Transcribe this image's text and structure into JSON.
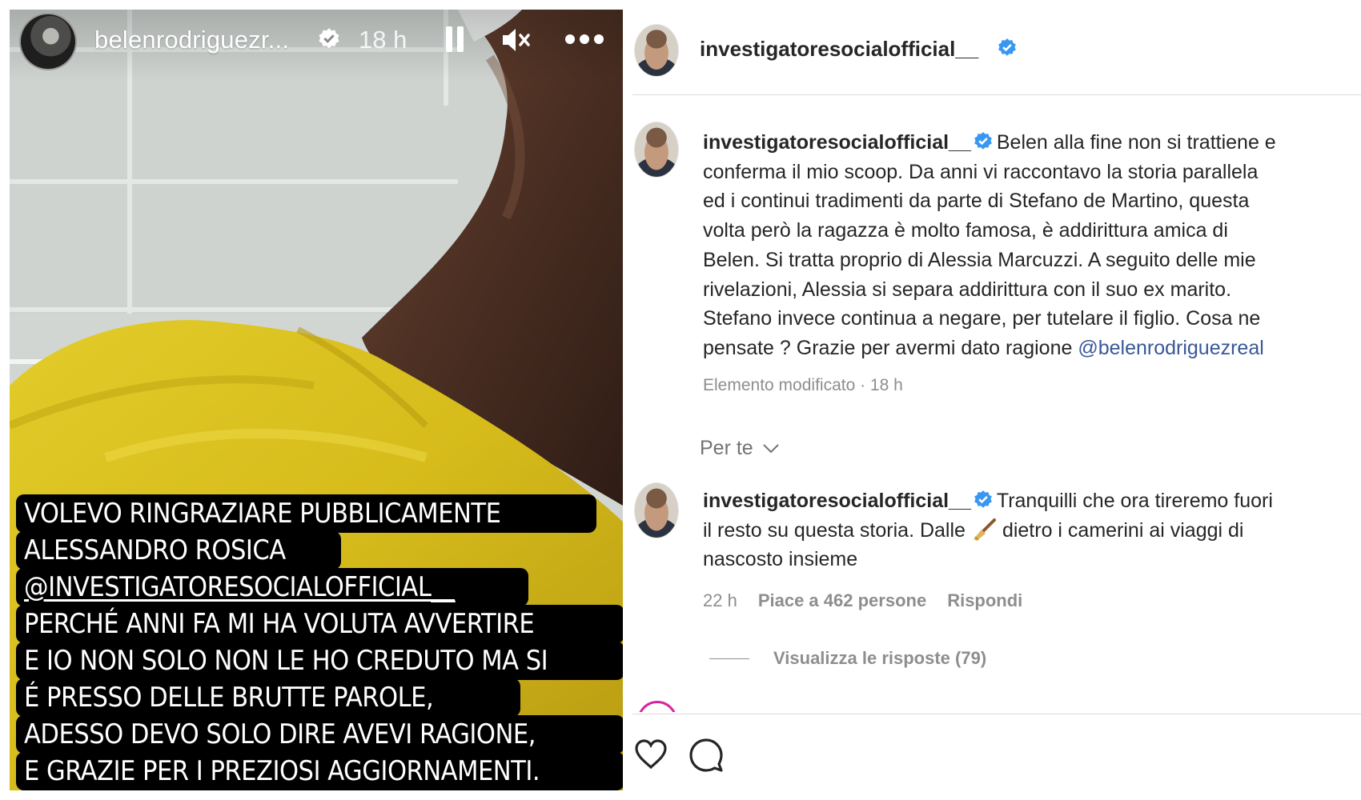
{
  "story": {
    "username": "belenrodriguezr...",
    "time": "18 h",
    "caption_lines": [
      "VOLEVO RINGRAZIARE PUBBLICAMENTE",
      "ALESSANDRO ROSICA",
      "@INVESTIGATORESOCIALOFFICIAL__",
      "PERCHÉ ANNI FA MI HA VOLUTA AVVERTIRE",
      "E IO NON SOLO NON LE HO CREDUTO MA SI",
      "É PRESSO DELLE BRUTTE PAROLE,",
      "ADESSO DEVO SOLO DIRE AVEVI RAGIONE,",
      "E GRAZIE PER I PREZIOSI AGGIORNAMENTI."
    ],
    "icons": [
      "verified-badge-icon",
      "pause-icon",
      "mute-icon",
      "more-icon"
    ]
  },
  "post": {
    "header_username": "investigatoresocialofficial__",
    "caption": {
      "username": "investigatoresocialofficial__",
      "lines": [
        "Belen alla fine non si trattiene e",
        "conferma il mio scoop. Da anni vi raccontavo la storia parallela",
        "ed i continui tradimenti da parte di Stefano de Martino, questa",
        "volta però la ragazza è molto famosa, è addirittura amica di",
        "Belen. Si tratta proprio di Alessia Marcuzzi. A seguito delle mie",
        "rivelazioni, Alessia si separa addirittura con il suo ex marito.",
        "Stefano invece continua a negare, per tutelare il figlio. Cosa ne",
        "pensate ? Grazie per avermi dato ragione "
      ],
      "mention": "@belenrodriguezreal",
      "meta": "Elemento modificato · 18 h"
    },
    "per_te_label": "Per te",
    "comment": {
      "username": "investigatoresocialofficial__",
      "text_before_emoji": "Tranquilli che ora tireremo fuori",
      "line2_before_emoji": "il resto su questa storia. Dalle",
      "line2_after_emoji": "dietro i camerini ai viaggi di",
      "line3": "nascosto insieme",
      "time": "22 h",
      "likes": "Piace a 462 persone",
      "reply": "Rispondi"
    },
    "view_replies": "Visualizza le risposte (79)",
    "colors": {
      "verified": "#3897f0",
      "mention": "#385898",
      "muted": "#8e8e8e",
      "caption_bg": "#000000",
      "caption_text": "#ffffff"
    }
  }
}
